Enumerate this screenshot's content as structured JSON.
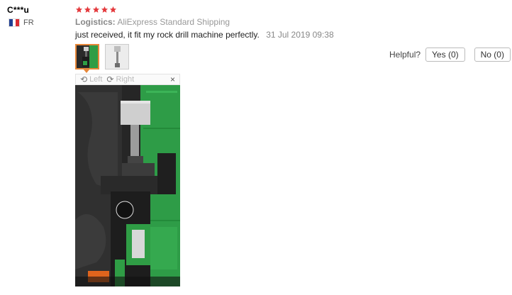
{
  "reviewer": {
    "name": "C***u",
    "country_code": "FR",
    "flag_colors": [
      "#1f3e93",
      "#ffffff",
      "#d92b32"
    ]
  },
  "review": {
    "stars": 5,
    "star_color": "#e4393c",
    "logistics_label": "Logistics:",
    "logistics_value": "AliExpress Standard Shipping",
    "text": "just received, it fit my rock drill machine perfectly.",
    "date": "31 Jul 2019 09:38",
    "accent_color": "#e7883a"
  },
  "viewer": {
    "left_label": "Left",
    "right_label": "Right",
    "left_icon": "rotate-left-icon",
    "right_icon": "rotate-right-icon",
    "close_icon": "close-icon"
  },
  "helpful": {
    "label": "Helpful?",
    "yes_label": "Yes (0)",
    "no_label": "No (0)"
  }
}
